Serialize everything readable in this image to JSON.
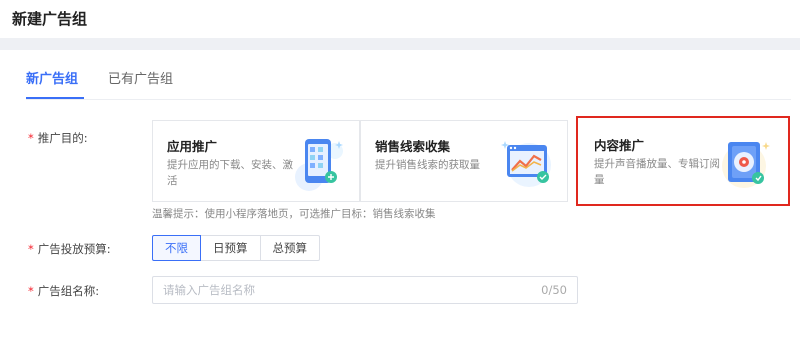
{
  "page": {
    "title": "新建广告组"
  },
  "tabs": [
    {
      "label": "新广告组",
      "active": true
    },
    {
      "label": "已有广告组",
      "active": false
    }
  ],
  "form": {
    "objective": {
      "label": "推广目的:",
      "required_mark": "*",
      "cards": [
        {
          "title": "应用推广",
          "description": "提升应用的下载、安装、激活",
          "icon": "phone-app-icon"
        },
        {
          "title": "销售线索收集",
          "description": "提升销售线索的获取量",
          "icon": "chart-window-icon"
        },
        {
          "title": "内容推广",
          "description": "提升声音播放量、专辑订阅量",
          "icon": "audio-album-icon",
          "highlighted": true
        }
      ],
      "tip": "温馨提示：使用小程序落地页，可选推广目标：销售线索收集"
    },
    "budget": {
      "label": "广告投放预算:",
      "required_mark": "*",
      "options": [
        {
          "label": "不限",
          "active": true
        },
        {
          "label": "日预算",
          "active": false
        },
        {
          "label": "总预算",
          "active": false
        }
      ]
    },
    "name": {
      "label": "广告组名称:",
      "required_mark": "*",
      "placeholder": "请输入广告组名称",
      "value": "",
      "counter": "0/50"
    }
  },
  "colors": {
    "accent": "#3a6ff7",
    "highlight_border": "#e0281e",
    "required": "#f5222d"
  }
}
